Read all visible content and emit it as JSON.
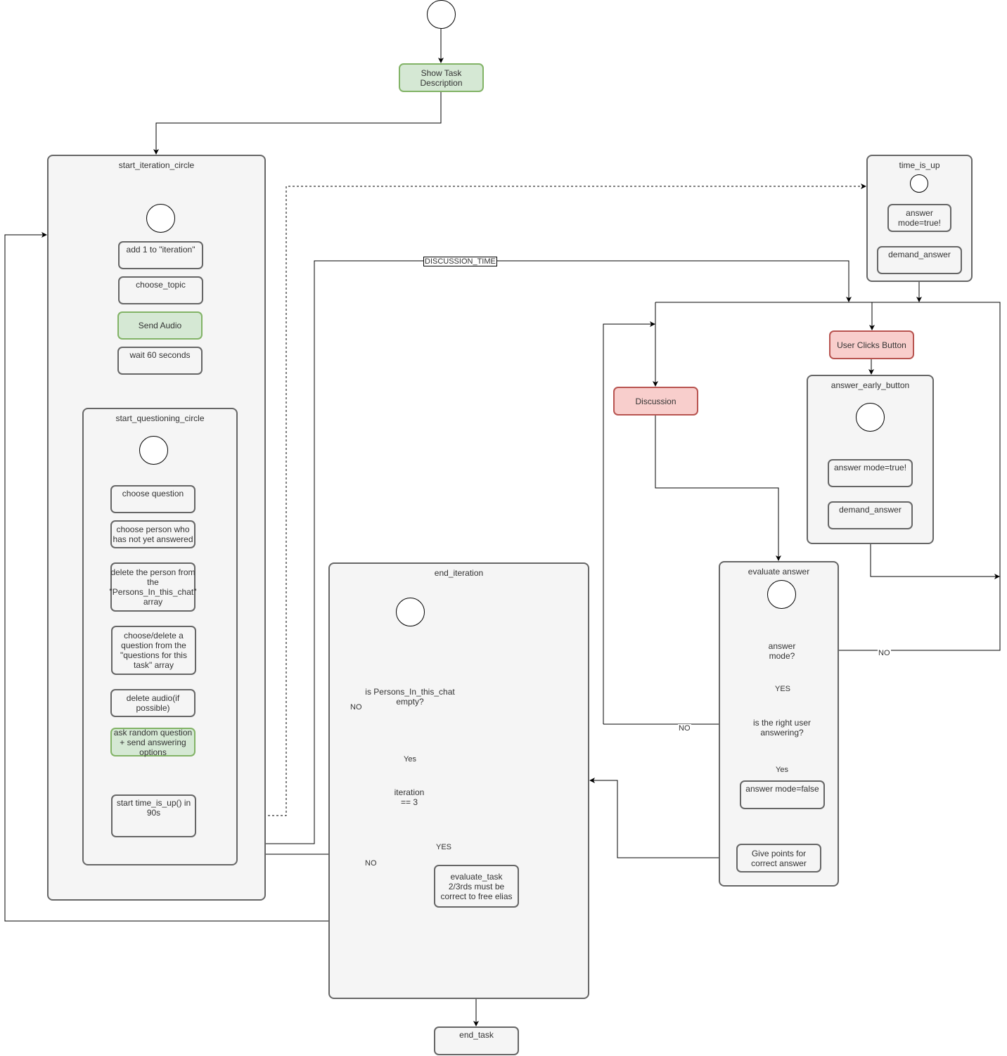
{
  "diagram": {
    "type": "activity-flowchart",
    "colors": {
      "container_fill": "#f5f5f5",
      "container_stroke": "#666666",
      "green_fill": "#d5e8d4",
      "green_stroke": "#82b366",
      "red_fill": "#f8cecc",
      "red_stroke": "#b85450",
      "edge": "#000000"
    },
    "nodes": {
      "show_task": "Show Task Description",
      "end_task": "end_task"
    },
    "containers": {
      "start_iteration_circle": {
        "title": "start_iteration_circle",
        "steps": [
          "add 1 to \"iteration\"",
          "choose_topic",
          "Send Audio",
          "wait 60 seconds"
        ]
      },
      "start_questioning_circle": {
        "title": "start_questioning_circle",
        "steps": [
          "choose question",
          "choose person who has not yet answered",
          "delete the person from the \"Persons_In_this_chat\" array",
          "choose/delete a question from the \"questions for this task\" array",
          "delete audio(if possible)",
          "ask random question + send answering options",
          "start time_is_up() in 90s"
        ]
      },
      "time_is_up": {
        "title": "time_is_up",
        "steps": [
          "answer mode=true!",
          "demand_answer"
        ]
      },
      "answer_early_button": {
        "title": "answer_early_button",
        "steps": [
          "answer mode=true!",
          "demand_answer"
        ]
      },
      "evaluate_answer": {
        "title": "evaluate answer",
        "decisions": [
          "answer mode?",
          "is the right user answering?"
        ],
        "steps": [
          "answer mode=false",
          "Give points for correct answer"
        ]
      },
      "end_iteration": {
        "title": "end_iteration",
        "decisions": [
          "is Persons_In_this_chat empty?",
          "iteration == 3"
        ],
        "steps": [
          "evaluate_task 2/3rds must be correct to free elias"
        ]
      }
    },
    "events": {
      "user_clicks_button": "User Clicks Button",
      "discussion": "Discussion"
    },
    "edge_labels": {
      "discussion_time": "DISCUSSION_TIME",
      "no": "NO",
      "yes_upper": "YES",
      "yes": "Yes"
    }
  }
}
